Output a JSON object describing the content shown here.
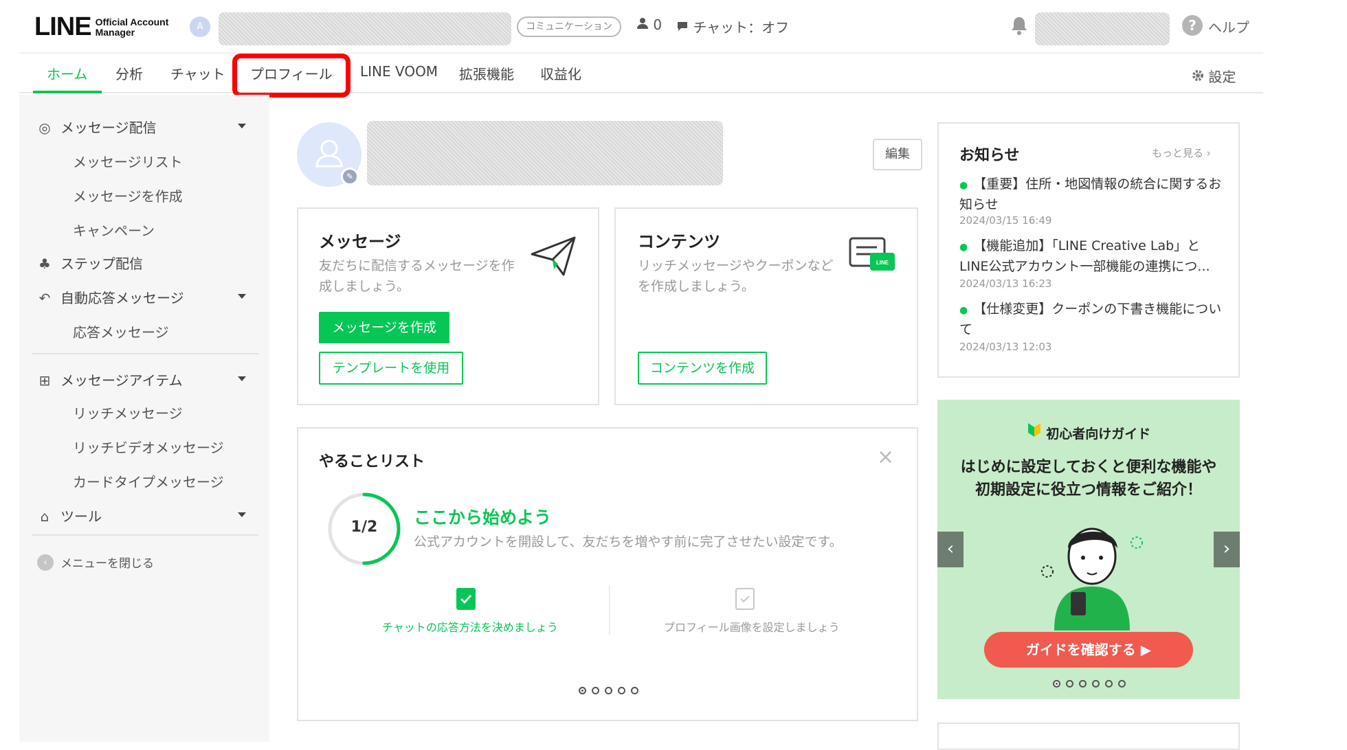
{
  "app": {
    "logo_main": "LINE",
    "logo_sub_1": "Official Account",
    "logo_sub_2": "Manager",
    "account_initial": "A"
  },
  "header": {
    "comm_badge": "コミュニケーション",
    "friends_count": "0",
    "chat_status": "チャット：オフ",
    "help": "ヘルプ"
  },
  "nav": {
    "tabs": [
      {
        "label": "ホーム",
        "active": true
      },
      {
        "label": "分析"
      },
      {
        "label": "チャット"
      },
      {
        "label": "プロフィール"
      },
      {
        "label": "LINE VOOM"
      },
      {
        "label": "拡張機能"
      },
      {
        "label": "収益化"
      }
    ],
    "settings": "設定"
  },
  "sidebar": {
    "groups": [
      {
        "label": "メッセージ配信",
        "icon": "broadcast-icon",
        "items": [
          "メッセージリスト",
          "メッセージを作成",
          "キャンペーン"
        ]
      },
      {
        "label": "ステップ配信",
        "icon": "step-tree-icon"
      },
      {
        "label": "自動応答メッセージ",
        "icon": "reply-icon",
        "items": [
          "応答メッセージ"
        ]
      },
      {
        "label": "メッセージアイテム",
        "icon": "add-box-icon",
        "items": [
          "リッチメッセージ",
          "リッチビデオメッセージ",
          "カードタイプメッセージ"
        ]
      },
      {
        "label": "ツール",
        "icon": "store-icon"
      }
    ],
    "close_menu": "メニューを閉じる"
  },
  "profile": {
    "edit": "編集"
  },
  "cards": {
    "message": {
      "title": "メッセージ",
      "desc": "友だちに配信するメッセージを作成しましょう。",
      "primary": "メッセージを作成",
      "secondary": "テンプレートを使用"
    },
    "content": {
      "title": "コンテンツ",
      "desc": "リッチメッセージやクーポンなどを作成しましょう。",
      "secondary": "コンテンツを作成",
      "icon_label": "LINE"
    }
  },
  "todo": {
    "title": "やることリスト",
    "progress_label": "1/2",
    "progress_fraction": 0.5,
    "head": "ここから始めよう",
    "desc": "公式アカウントを開設して、友だちを増やす前に完了させたい設定です。",
    "steps": [
      {
        "label": "チャットの応答方法を決めましょう",
        "done": true
      },
      {
        "label": "プロフィール画像を設定しましょう",
        "done": false
      }
    ],
    "page_dots": 5
  },
  "news": {
    "title": "お知らせ",
    "more": "もっと見る",
    "items": [
      {
        "text": "【重要】住所・地図情報の統合に関するお知らせ",
        "date": "2024/03/15 16:49"
      },
      {
        "text": "【機能追加】「LINE Creative Lab」とLINE公式アカウント一部機能の連携につ...",
        "date": "2024/03/13 16:23"
      },
      {
        "text": "【仕様変更】クーポンの下書き機能について",
        "date": "2024/03/13 12:03"
      }
    ]
  },
  "banner": {
    "tag": "初心者向けガイド",
    "line1": "はじめに設定しておくと便利な機能や",
    "line2": "初期設定に役立つ情報をご紹介！",
    "button": "ガイドを確認する",
    "page_dots": 6
  },
  "colors": {
    "brand_green": "#06c755",
    "highlight_red": "#ff0000",
    "banner_bg": "#c7ecc9",
    "banner_button": "#f05a4f"
  }
}
